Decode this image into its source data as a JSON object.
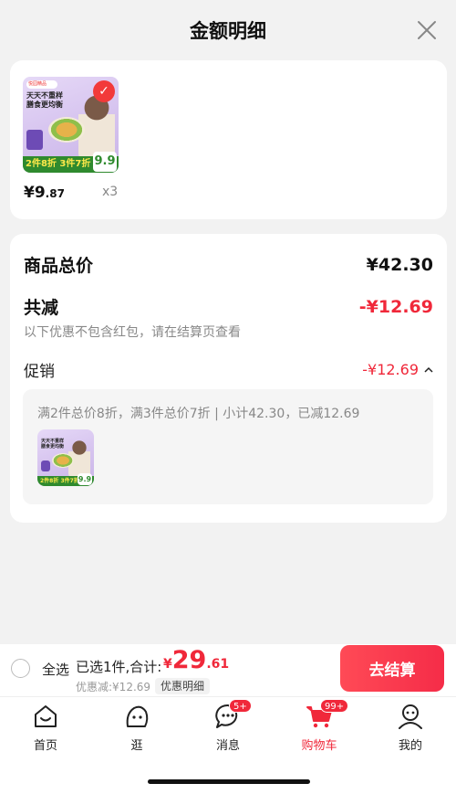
{
  "header": {
    "title": "金额明细"
  },
  "product": {
    "thumb_brand": "悦园精品",
    "thumb_headline_1": "天天不重样",
    "thumb_headline_2": "膳食更均衡",
    "thumb_promo": "2件8折 3件7折",
    "thumb_price": "9.9",
    "price_int": "¥9",
    "price_dec": ".87",
    "qty": "x3"
  },
  "summary": {
    "total_label": "商品总价",
    "total_value": "¥42.30",
    "discount_label": "共减",
    "discount_value": "-¥12.69",
    "note": "以下优惠不包含红包，请在结算页查看",
    "promo_label": "促销",
    "promo_value": "-¥12.69",
    "promo_desc": "满2件总价8折，满3件总价7折 | 小计42.30，已减12.69"
  },
  "bottom_bar": {
    "select_all": "全选",
    "selected_info": "已选1件,合计:",
    "total_currency": "¥",
    "total_int": "29",
    "total_dec": ".61",
    "discount_line": "优惠减:¥12.69",
    "detail_chip": "优惠明细",
    "checkout": "去结算"
  },
  "tabbar": {
    "home": "首页",
    "browse": "逛",
    "messages": "消息",
    "messages_badge": "5+",
    "cart": "购物车",
    "cart_badge": "99+",
    "mine": "我的",
    "active_color": "#f0283a"
  }
}
